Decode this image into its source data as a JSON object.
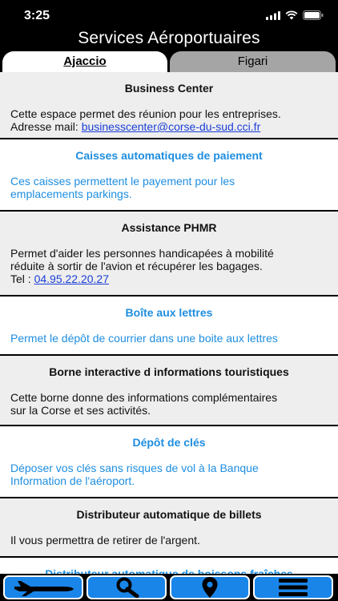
{
  "status": {
    "time": "3:25"
  },
  "header": {
    "title": "Services Aéroportuaires"
  },
  "tabs": [
    {
      "label": "Ajaccio",
      "active": true
    },
    {
      "label": "Figari",
      "active": false
    }
  ],
  "services": [
    {
      "title": "Business Center",
      "lines": [
        "Cette espace permet des réunion pour les entreprises."
      ],
      "email_label": "Adresse mail: ",
      "email": "businesscenter@corse-du-sud.cci.fr"
    },
    {
      "title": "Caisses automatiques de paiement",
      "lines": [
        "Ces caisses permettent le payement pour les",
        "emplacements parkings."
      ]
    },
    {
      "title": "Assistance PHMR",
      "lines": [
        "Permet d'aider les personnes handicapées à mobilité",
        "réduite à sortir de l'avion et récupérer les bagages."
      ],
      "phone_label": "Tel : ",
      "phone": "04.95.22.20.27"
    },
    {
      "title": "Boîte aux lettres",
      "lines": [
        "Permet le dépôt de courrier dans une boite aux lettres"
      ]
    },
    {
      "title": "Borne interactive d informations touristiques",
      "lines": [
        "Cette borne donne des informations complémentaires",
        "sur la Corse et ses activités."
      ]
    },
    {
      "title": "Dépôt de clés",
      "lines": [
        "Déposer vos clés sans risques de vol à la Banque",
        "Information de l'aéroport."
      ]
    },
    {
      "title": "Distributeur automatique de billets",
      "lines": [
        "Il vous permettra de retirer de l'argent."
      ]
    },
    {
      "title": "Distributeur automatique de boissons fraîches",
      "lines": []
    }
  ],
  "bottom_nav": [
    {
      "icon": "airplane-icon"
    },
    {
      "icon": "search-icon"
    },
    {
      "icon": "location-pin-icon"
    },
    {
      "icon": "menu-icon"
    }
  ],
  "colors": {
    "accent_blue": "#1e8ee0",
    "link_blue": "#1a3fd6",
    "nav_blue": "#1a85e8"
  }
}
